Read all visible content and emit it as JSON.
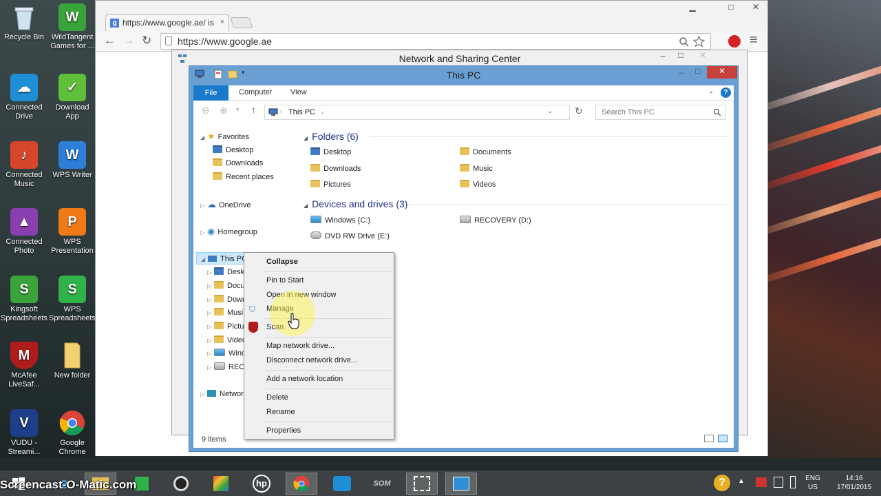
{
  "desktop_icons": [
    {
      "label": "Recycle Bin",
      "color": "#8aa7b8",
      "glyph": "🗑"
    },
    {
      "label": "WildTangent Games for ...",
      "color": "#3aa33a",
      "glyph": "W"
    },
    {
      "label": "Connected Drive",
      "color": "#1e8fd6",
      "glyph": "☁"
    },
    {
      "label": "Download App",
      "color": "#5fbf3a",
      "glyph": "✓"
    },
    {
      "label": "Connected Music",
      "color": "#d8462a",
      "glyph": "♪"
    },
    {
      "label": "WPS Writer",
      "color": "#2e7fd8",
      "glyph": "W"
    },
    {
      "label": "Connected Photo",
      "color": "#8a3fb0",
      "glyph": "▲"
    },
    {
      "label": "WPS Presentation",
      "color": "#f07a18",
      "glyph": "P"
    },
    {
      "label": "Kingsoft Spreadsheets",
      "color": "#3aa33a",
      "glyph": "S"
    },
    {
      "label": "WPS Spreadsheets",
      "color": "#2fb24a",
      "glyph": "S"
    },
    {
      "label": "McAfee LiveSaf...",
      "color": "#b01c1c",
      "glyph": "M"
    },
    {
      "label": "New folder",
      "color": "#e8c25a",
      "glyph": ""
    },
    {
      "label": "VUDU - Streami...",
      "color": "#1f3e8a",
      "glyph": "V"
    },
    {
      "label": "Google Chrome",
      "color": "#d94b3a",
      "glyph": "◉"
    }
  ],
  "chrome": {
    "tab_label": "https://www.google.ae/ is",
    "tab_close": "×",
    "url": "https://www.google.ae",
    "back": "←",
    "forward": "→",
    "reload": "↻",
    "min": "▁",
    "max": "□",
    "close": "✕",
    "menu": "≡"
  },
  "nsc": {
    "title": "Network and Sharing Center",
    "min": "–",
    "max": "□",
    "close": "✕"
  },
  "explorer": {
    "title": "This PC",
    "min": "–",
    "max": "□",
    "close": "✕",
    "ribbon_tabs": [
      "File",
      "Computer",
      "View"
    ],
    "address": "This PC",
    "search_placeholder": "Search This PC",
    "nav": {
      "favorites": "Favorites",
      "fav_items": [
        "Desktop",
        "Downloads",
        "Recent places"
      ],
      "onedrive": "OneDrive",
      "homegroup": "Homegroup",
      "thispc": "This PC",
      "pc_items": [
        "Deskt",
        "Docu",
        "Down",
        "Musi",
        "Pictu",
        "Video",
        "Wind",
        "RECO"
      ],
      "network": "Networ"
    },
    "folders_header": "Folders (6)",
    "folders": [
      "Desktop",
      "Documents",
      "Downloads",
      "Music",
      "Pictures",
      "Videos"
    ],
    "devices_header": "Devices and drives (3)",
    "drives": [
      "Windows (C:)",
      "RECOVERY (D:)",
      "DVD RW Drive (E:)"
    ],
    "status": "9 items"
  },
  "context_menu": {
    "items": [
      "Collapse",
      "Pin to Start",
      "Open in new window",
      "Manage",
      "Scan",
      "Map network drive...",
      "Disconnect network drive...",
      "Add a network location",
      "Delete",
      "Rename",
      "Properties"
    ]
  },
  "watermark": "Screencast-O-Matic.com",
  "tray": {
    "lang_top": "ENG",
    "lang_bottom": "US",
    "time": "14:16",
    "date": "17/01/2015"
  },
  "colors": {
    "accent_blue": "#1979ca",
    "explorer_frame": "#6a9fd4",
    "taskbar": "#3d4143"
  }
}
